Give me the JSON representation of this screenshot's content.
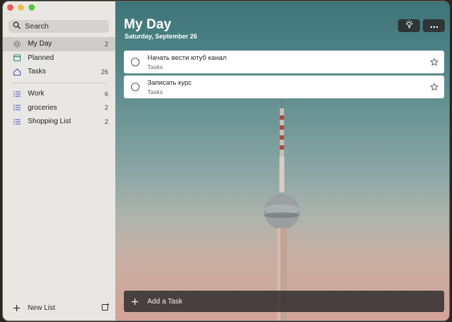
{
  "sidebar": {
    "search_label": "Search",
    "smart_lists": [
      {
        "label": "My Day",
        "count": "2",
        "icon": "sun-icon"
      },
      {
        "label": "Planned",
        "count": "",
        "icon": "calendar-icon"
      },
      {
        "label": "Tasks",
        "count": "26",
        "icon": "home-icon"
      }
    ],
    "lists": [
      {
        "label": "Work",
        "count": "6",
        "icon": "list-icon"
      },
      {
        "label": "groceries",
        "count": "2",
        "icon": "list-icon"
      },
      {
        "label": "Shopping List",
        "count": "2",
        "icon": "list-icon"
      }
    ],
    "new_list_label": "New List"
  },
  "header": {
    "title": "My Day",
    "date": "Saturday, September 26"
  },
  "tasks": [
    {
      "title": "Начать вести ютуб канал",
      "list": "Tasks"
    },
    {
      "title": "Записать курс",
      "list": "Tasks"
    }
  ],
  "add_task_label": "Add a Task",
  "colors": {
    "sidebar_bg": "#e9e7e3",
    "active_item": "#cfcdca",
    "list_icon": "#4a55c8",
    "my_day_icon": "#6a6a6a"
  }
}
